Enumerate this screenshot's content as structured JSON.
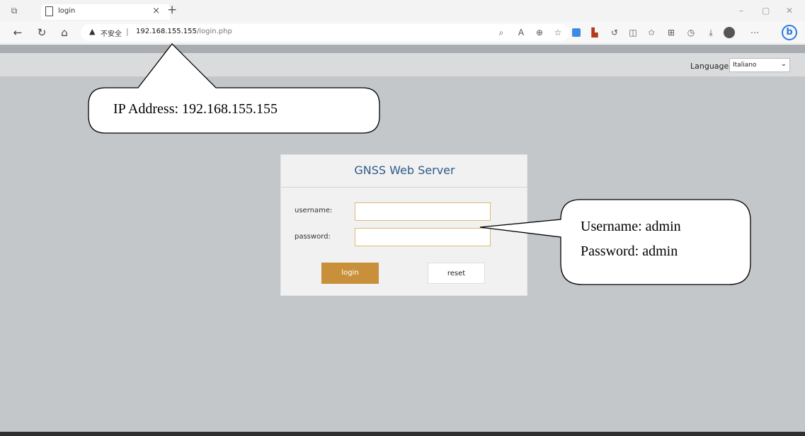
{
  "browser": {
    "tab_title": "login",
    "new_tab_glyph": "+",
    "address_warning": "不安全",
    "address_host": "192.168.155.155",
    "address_path": "/login.php"
  },
  "page": {
    "language_label": "Language :",
    "language_value": "Italiano",
    "panel_title": "GNSS Web Server",
    "username_label": "username:",
    "password_label": "password:",
    "login_label": "login",
    "reset_label": "reset"
  },
  "annotations": {
    "ip_callout": "IP Address: 192.168.155.155",
    "cred_username": "Username: admin",
    "cred_password": "Password: admin"
  },
  "icons": [
    "tab-actions-icon",
    "page-icon",
    "close-icon",
    "back-icon",
    "refresh-icon",
    "home-icon",
    "warning-icon",
    "search-icon",
    "read-aloud-icon",
    "zoom-icon",
    "favorite-icon",
    "extension-icon",
    "split-screen-icon",
    "favorites-list-icon",
    "collections-icon",
    "history-icon",
    "download-icon",
    "profile-icon",
    "more-icon",
    "bing-icon"
  ],
  "colors": {
    "page_bg": "#c4c7ca",
    "panel_title": "#2e5c86",
    "login_button": "#c9903b",
    "input_border": "#e0b873"
  }
}
